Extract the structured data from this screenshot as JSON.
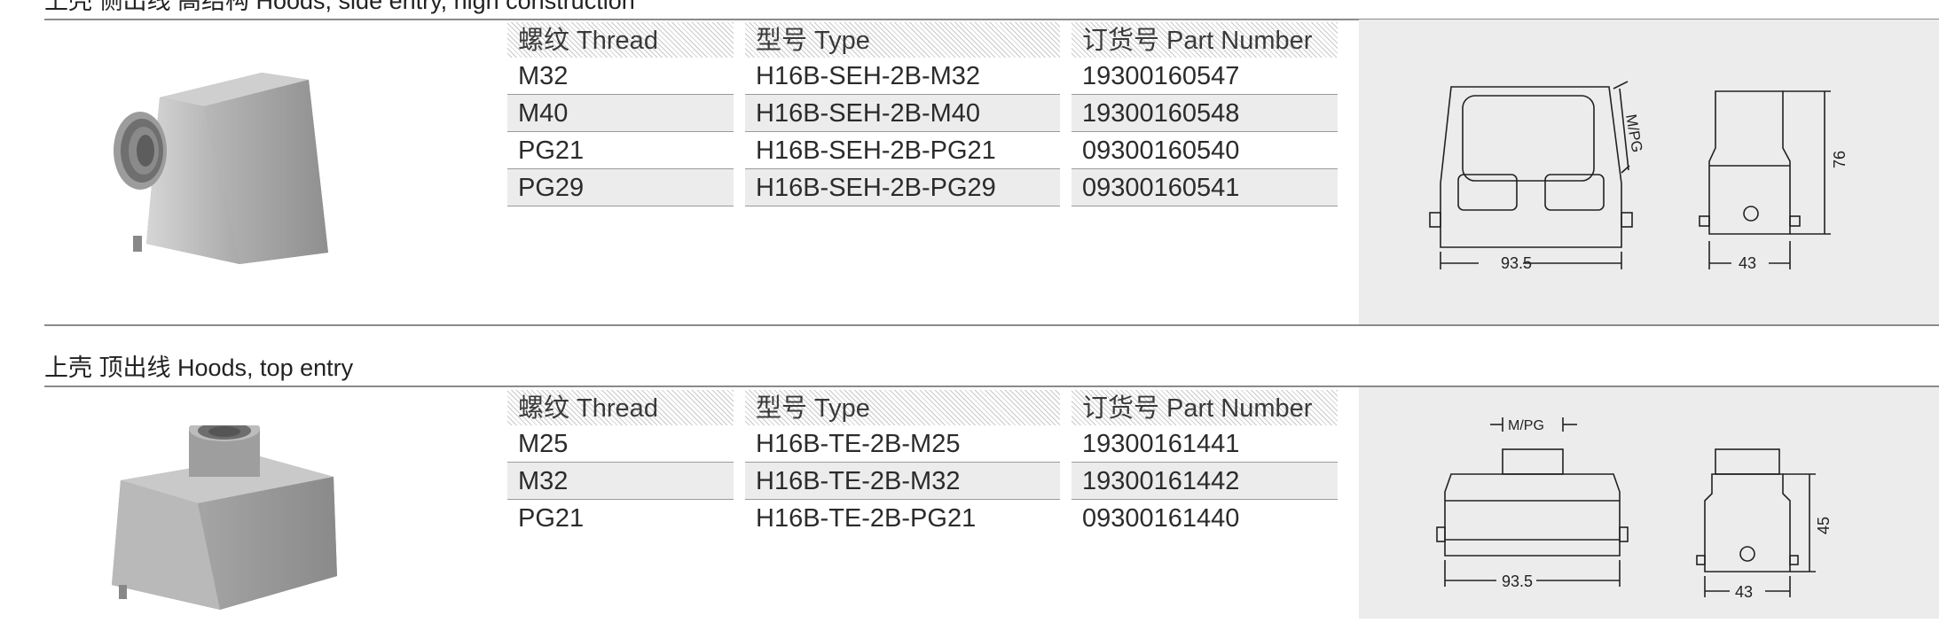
{
  "sections": [
    {
      "title": "上壳 侧出线 高结构 Hoods, side entry, high construction",
      "headers": {
        "thread": "螺纹 Thread",
        "type": "型号 Type",
        "part": "订货号 Part Number"
      },
      "rows": [
        {
          "thread": "M32",
          "type": "H16B-SEH-2B-M32",
          "part": "19300160547"
        },
        {
          "thread": "M40",
          "type": "H16B-SEH-2B-M40",
          "part": "19300160548"
        },
        {
          "thread": "PG21",
          "type": "H16B-SEH-2B-PG21",
          "part": "09300160540"
        },
        {
          "thread": "PG29",
          "type": "H16B-SEH-2B-PG29",
          "part": "09300160541"
        }
      ],
      "drawing": {
        "width_label": "93.5",
        "depth_label": "43",
        "height_label": "76",
        "thread_label": "M/PG"
      }
    },
    {
      "title": "上壳 顶出线  Hoods, top entry",
      "headers": {
        "thread": "螺纹 Thread",
        "type": "型号 Type",
        "part": "订货号 Part Number"
      },
      "rows": [
        {
          "thread": "M25",
          "type": "H16B-TE-2B-M25",
          "part": "19300161441"
        },
        {
          "thread": "M32",
          "type": "H16B-TE-2B-M32",
          "part": "19300161442"
        },
        {
          "thread": "PG21",
          "type": "H16B-TE-2B-PG21",
          "part": "09300161440"
        }
      ],
      "drawing": {
        "width_label": "93.5",
        "depth_label": "43",
        "height_label": "45",
        "thread_label": "M/PG"
      }
    }
  ]
}
